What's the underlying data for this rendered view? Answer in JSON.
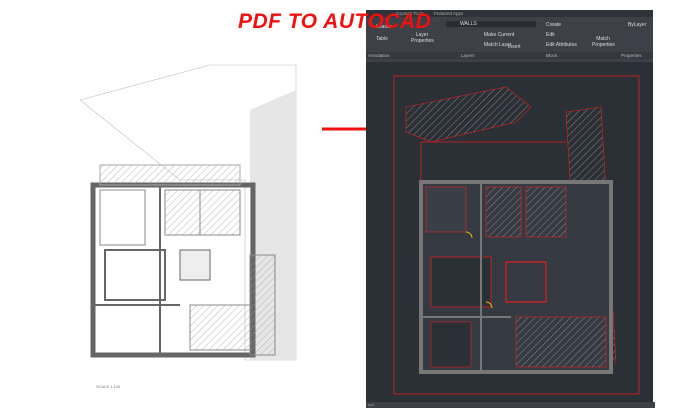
{
  "title": "PDF TO AUTOCAD",
  "left_plan": {
    "scale_label": "SCALE 1:100"
  },
  "ribbon": {
    "tabs": [
      "Express Tools",
      "Featured Apps"
    ],
    "annotation": {
      "leader": "Leader",
      "table": "Table",
      "panel": "Annotation"
    },
    "layers": {
      "layer_properties": "Layer Properties",
      "layer_name": "WALLS",
      "make_current": "Make Current",
      "match_layer": "Match Layer",
      "panel": "Layers"
    },
    "block": {
      "insert": "Insert",
      "create": "Create",
      "edit": "Edit",
      "edit_attributes": "Edit Attributes",
      "panel": "Block"
    },
    "properties": {
      "match_properties": "Match Properties",
      "bylayer": "ByLayer",
      "panel": "Properties"
    }
  },
  "status": {
    "command": "ord"
  },
  "colors": {
    "accent": "#f01010",
    "cad_bg": "#2b2f36",
    "cad_line": "#e02020"
  }
}
